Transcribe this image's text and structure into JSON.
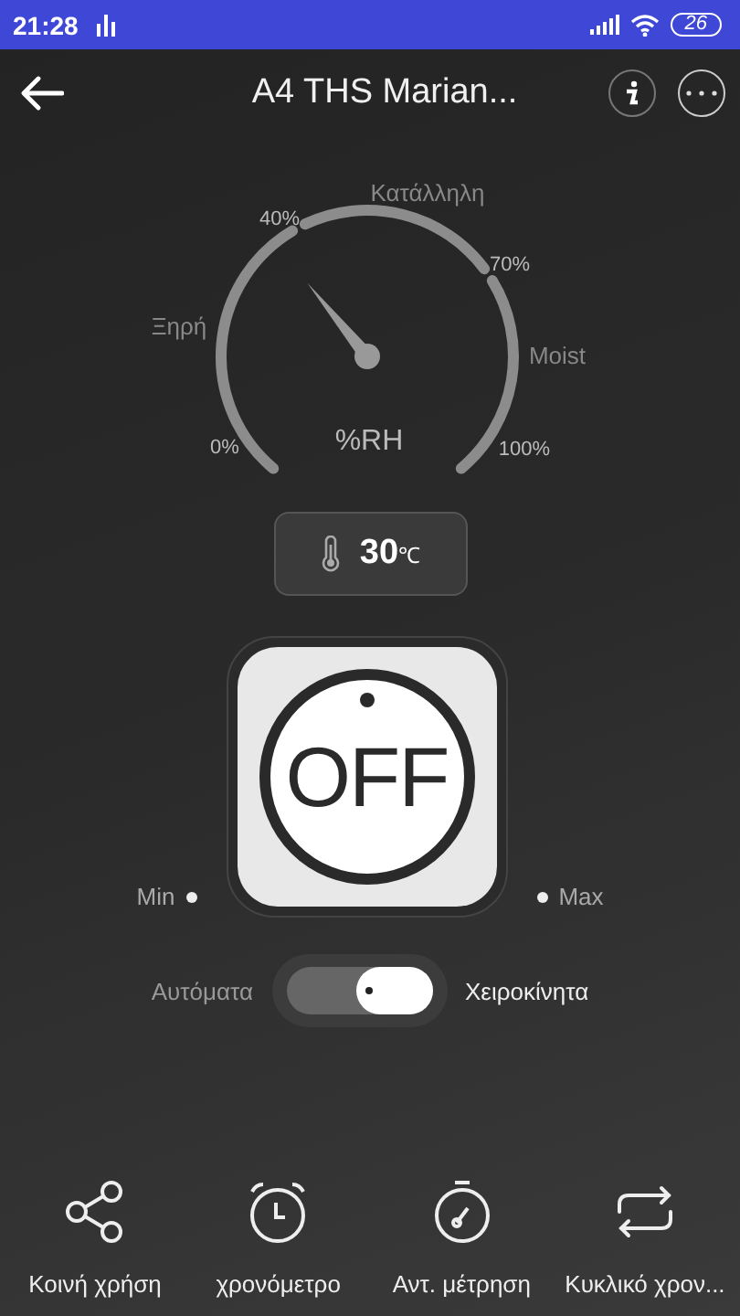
{
  "status_bar": {
    "time": "21:28",
    "battery": "26"
  },
  "header": {
    "title": "A4 THS Marian..."
  },
  "gauge": {
    "unit": "%RH",
    "ticks": [
      "0%",
      "40%",
      "70%",
      "100%"
    ],
    "zones": [
      "Ξηρή",
      "Κατάλληλη",
      "Moist"
    ]
  },
  "temperature": {
    "value": "30",
    "unit": "℃"
  },
  "power": {
    "label": "OFF",
    "on": false,
    "min_label": "Min",
    "max_label": "Max"
  },
  "mode": {
    "options": [
      {
        "label": "Αυτόματα",
        "selected": false
      },
      {
        "label": "Χειροκίνητα",
        "selected": true
      }
    ]
  },
  "bottom_bar": [
    {
      "kind": "share",
      "label": "Κοινή χρήση"
    },
    {
      "kind": "alarm",
      "label": "χρονόμετρο"
    },
    {
      "kind": "stopwatch",
      "label": "Αντ. μέτρηση"
    },
    {
      "kind": "repeat",
      "label": "Κυκλικό χρον..."
    }
  ]
}
